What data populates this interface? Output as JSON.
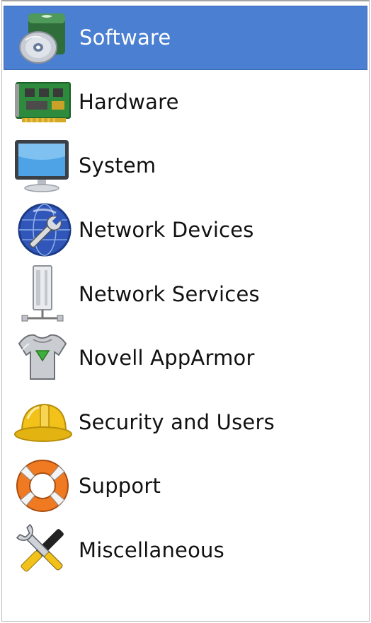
{
  "categories": [
    {
      "label": "Software",
      "icon": "software-cd-icon",
      "selected": true
    },
    {
      "label": "Hardware",
      "icon": "circuit-board-icon",
      "selected": false
    },
    {
      "label": "System",
      "icon": "monitor-icon",
      "selected": false
    },
    {
      "label": "Network Devices",
      "icon": "globe-wrench-icon",
      "selected": false
    },
    {
      "label": "Network Services",
      "icon": "server-tower-icon",
      "selected": false
    },
    {
      "label": "Novell AppArmor",
      "icon": "armor-icon",
      "selected": false
    },
    {
      "label": "Security and Users",
      "icon": "hard-hat-icon",
      "selected": false
    },
    {
      "label": "Support",
      "icon": "lifebuoy-icon",
      "selected": false
    },
    {
      "label": "Miscellaneous",
      "icon": "tools-icon",
      "selected": false
    }
  ],
  "colors": {
    "selection": "#4a7fd1",
    "selected_text": "#ffffff",
    "text": "#111111"
  }
}
